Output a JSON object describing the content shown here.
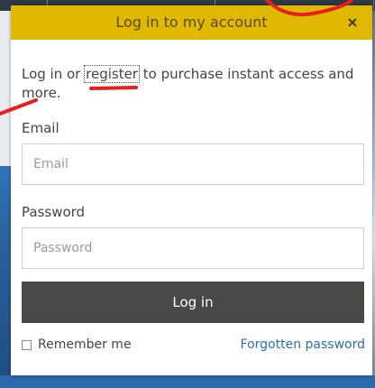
{
  "modal": {
    "title": "Log in to my account",
    "close_glyph": "×",
    "intro_before": "Log in or ",
    "intro_link": "register",
    "intro_after": " to purchase instant access and more.",
    "email_label": "Email",
    "email_placeholder": "Email",
    "password_label": "Password",
    "password_placeholder": "Password",
    "login_button": "Log in",
    "remember_label": "Remember me",
    "forgot_link": "Forgotten password"
  },
  "colors": {
    "header": "#e1b800",
    "button": "#4a4948",
    "link": "#2b6fb0",
    "annotation": "#e5201f"
  }
}
